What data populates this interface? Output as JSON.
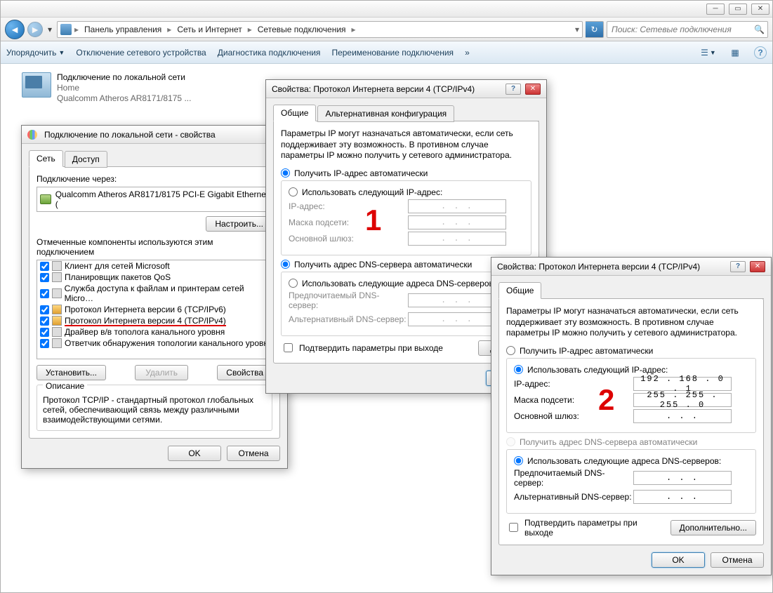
{
  "breadcrumb": {
    "seg1": "Панель управления",
    "seg2": "Сеть и Интернет",
    "seg3": "Сетевые подключения"
  },
  "search": {
    "placeholder": "Поиск: Сетевые подключения"
  },
  "toolbar": {
    "organize": "Упорядочить",
    "disable": "Отключение сетевого устройства",
    "diagnose": "Диагностика подключения",
    "rename": "Переименование подключения",
    "more": "»"
  },
  "connection": {
    "name": "Подключение по локальной сети",
    "status": "Home",
    "hw": "Qualcomm Atheros AR8171/8175 ..."
  },
  "lanprops": {
    "title": "Подключение по локальной сети - свойства",
    "tab_net": "Сеть",
    "tab_access": "Доступ",
    "conn_via": "Подключение через:",
    "adapter": "Qualcomm Atheros AR8171/8175 PCI-E Gigabit Ethernet (",
    "configure": "Настроить...",
    "components_label": "Отмеченные компоненты используются этим подключением",
    "items": [
      "Клиент для сетей Microsoft",
      "Планировщик пакетов QoS",
      "Служба доступа к файлам и принтерам сетей Micro…",
      "Протокол Интернета версии 6 (TCP/IPv6)",
      "Протокол Интернета версии 4 (TCP/IPv4)",
      "Драйвер в/в тополога канального уровня",
      "Ответчик обнаружения топологии канального уровн"
    ],
    "install": "Установить...",
    "uninstall": "Удалить",
    "properties": "Свойства",
    "desc_title": "Описание",
    "desc_text": "Протокол TCP/IP - стандартный протокол глобальных сетей, обеспечивающий связь между различными взаимодействующими сетями.",
    "ok": "OK",
    "cancel": "Отмена"
  },
  "ipv4": {
    "title": "Свойства: Протокол Интернета версии 4 (TCP/IPv4)",
    "tab_general": "Общие",
    "tab_alt": "Альтернативная конфигурация",
    "help": "Параметры IP могут назначаться автоматически, если сеть поддерживает эту возможность. В противном случае параметры IP можно получить у сетевого администратора.",
    "auto_ip": "Получить IP-адрес автоматически",
    "manual_ip": "Использовать следующий IP-адрес:",
    "ip_label": "IP-адрес:",
    "mask_label": "Маска подсети:",
    "gw_label": "Основной шлюз:",
    "auto_dns": "Получить адрес DNS-сервера автоматически",
    "manual_dns": "Использовать следующие адреса DNS-серверов:",
    "pref_dns": "Предпочитаемый DNS-сервер:",
    "alt_dns": "Альтернативный DNS-сервер:",
    "validate": "Подтвердить параметры при выходе",
    "advanced": "Дополнительно...",
    "ok": "OK",
    "cancel": "Отмена",
    "dlg2": {
      "ip": "192 . 168 .  0  .  1",
      "mask": "255 . 255 . 255 .  0",
      "gw": ".       .       .",
      "pref": ".       .       .",
      "alt": ".       .       ."
    },
    "placeholder_dots": ".       .       ."
  },
  "annot": {
    "one": "1",
    "two": "2"
  }
}
